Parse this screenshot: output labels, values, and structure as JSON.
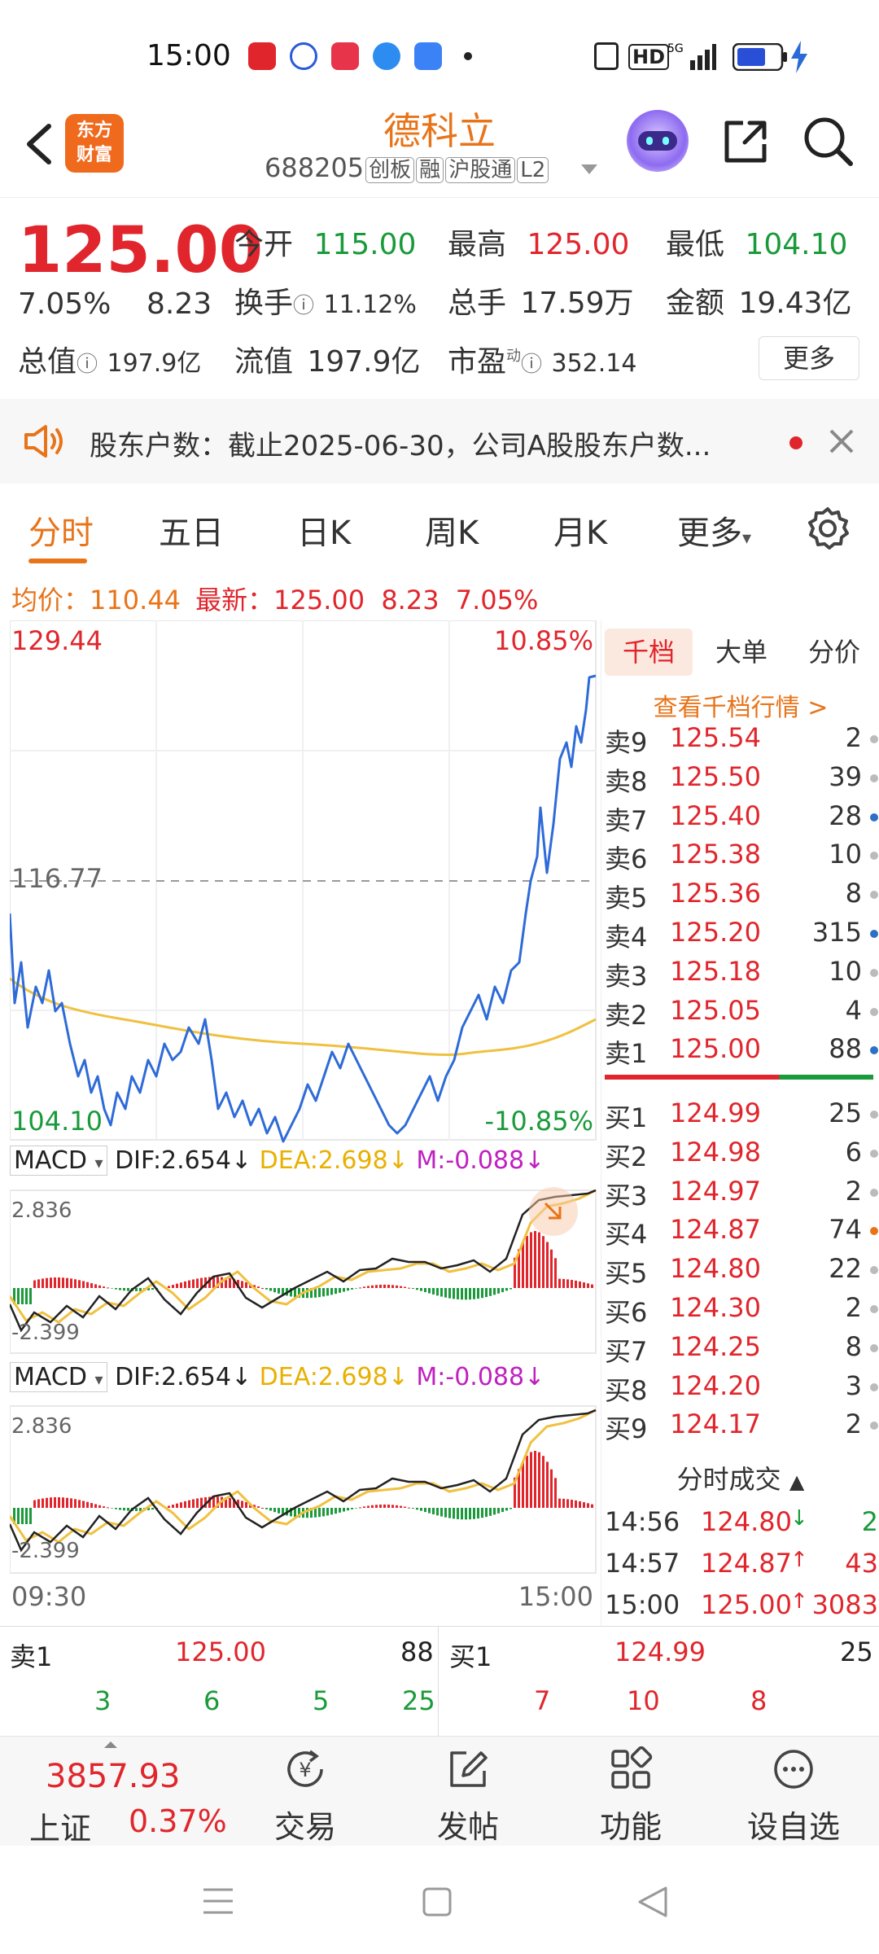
{
  "status": {
    "time": "15:00"
  },
  "header": {
    "name": "德科立",
    "code": "688205",
    "tags": [
      "创板",
      "融",
      "沪股通",
      "L2"
    ],
    "logo_line1": "东方",
    "logo_line2": "财富"
  },
  "quote": {
    "price": "125.00",
    "pct": "7.05%",
    "chg": "8.23",
    "open_lbl": "今开",
    "open": "115.00",
    "high_lbl": "最高",
    "high": "125.00",
    "low_lbl": "最低",
    "low": "104.10",
    "turnover_lbl": "换手",
    "turnover": "11.12%",
    "volume_lbl": "总手",
    "volume": "17.59万",
    "amount_lbl": "金额",
    "amount": "19.43亿",
    "mcap_lbl": "总值",
    "mcap": "197.9亿",
    "float_lbl": "流值",
    "float": "197.9亿",
    "pe_lbl": "市盈",
    "pe_sup": "动",
    "pe": "352.14",
    "more": "更多"
  },
  "notice": {
    "text": "股东户数：截止2025-06-30，公司A股股东户数..."
  },
  "tabs": [
    "分时",
    "五日",
    "日K",
    "周K",
    "月K",
    "更多"
  ],
  "avg": {
    "avg_lbl": "均价：",
    "avg": "110.44",
    "last_lbl": "最新：",
    "last": "125.00",
    "chg": "8.23",
    "pct": "7.05%"
  },
  "chart": {
    "top_price": "129.44",
    "top_pct": "10.85%",
    "mid_price": "116.77",
    "bottom_price": "104.10",
    "bottom_pct": "-10.85%",
    "start_time": "09:30",
    "end_time": "15:00",
    "macd1": {
      "name": "MACD",
      "dif": "DIF:2.654",
      "dea": "DEA:2.698",
      "m": "M:-0.088",
      "top": "2.836",
      "bottom": "-2.399"
    },
    "macd2": {
      "name": "MACD",
      "dif": "DIF:2.654",
      "dea": "DEA:2.698",
      "m": "M:-0.088",
      "top": "2.836",
      "bottom": "-2.399"
    }
  },
  "book": {
    "tabs": [
      "千档",
      "大单",
      "分价"
    ],
    "link": "查看千档行情 >",
    "asks": [
      {
        "lab": "卖9",
        "price": "125.54",
        "vol": "2",
        "dot": "#bbb"
      },
      {
        "lab": "卖8",
        "price": "125.50",
        "vol": "39",
        "dot": "#bbb"
      },
      {
        "lab": "卖7",
        "price": "125.40",
        "vol": "28",
        "dot": "#2f6fc4"
      },
      {
        "lab": "卖6",
        "price": "125.38",
        "vol": "10",
        "dot": "#bbb"
      },
      {
        "lab": "卖5",
        "price": "125.36",
        "vol": "8",
        "dot": "#bbb"
      },
      {
        "lab": "卖4",
        "price": "125.20",
        "vol": "315",
        "dot": "#2f6fc4"
      },
      {
        "lab": "卖3",
        "price": "125.18",
        "vol": "10",
        "dot": "#bbb"
      },
      {
        "lab": "卖2",
        "price": "125.05",
        "vol": "4",
        "dot": "#bbb"
      },
      {
        "lab": "卖1",
        "price": "125.00",
        "vol": "88",
        "dot": "#2f6fc4"
      }
    ],
    "bids": [
      {
        "lab": "买1",
        "price": "124.99",
        "vol": "25",
        "dot": "#bbb"
      },
      {
        "lab": "买2",
        "price": "124.98",
        "vol": "6",
        "dot": "#bbb"
      },
      {
        "lab": "买3",
        "price": "124.97",
        "vol": "2",
        "dot": "#bbb"
      },
      {
        "lab": "买4",
        "price": "124.87",
        "vol": "74",
        "dot": "#e8741a"
      },
      {
        "lab": "买5",
        "price": "124.80",
        "vol": "22",
        "dot": "#bbb"
      },
      {
        "lab": "买6",
        "price": "124.30",
        "vol": "2",
        "dot": "#bbb"
      },
      {
        "lab": "买7",
        "price": "124.25",
        "vol": "8",
        "dot": "#bbb"
      },
      {
        "lab": "买8",
        "price": "124.20",
        "vol": "3",
        "dot": "#bbb"
      },
      {
        "lab": "买9",
        "price": "124.17",
        "vol": "2",
        "dot": "#bbb"
      }
    ],
    "ticks_title": "分时成交",
    "ticks": [
      {
        "time": "14:56",
        "price": "124.80",
        "arrow": "↓",
        "vol": "2",
        "dir": "down"
      },
      {
        "time": "14:57",
        "price": "124.87",
        "arrow": "↑",
        "vol": "43",
        "dir": "up"
      },
      {
        "time": "15:00",
        "price": "125.00",
        "arrow": "↑",
        "vol": "3083",
        "dir": "up"
      }
    ]
  },
  "strip": {
    "ask_lbl": "卖1",
    "ask_price": "125.00",
    "ask_vol": "88",
    "bid_lbl": "买1",
    "bid_price": "124.99",
    "bid_vol": "25",
    "ask_q": [
      "3",
      "6",
      "5",
      "25"
    ],
    "bid_q": [
      "7",
      "10",
      "8"
    ]
  },
  "nav": {
    "index_value": "3857.93",
    "index_name": "上证",
    "index_pct": "0.37%",
    "items": [
      "交易",
      "发帖",
      "功能",
      "设自选"
    ]
  }
}
